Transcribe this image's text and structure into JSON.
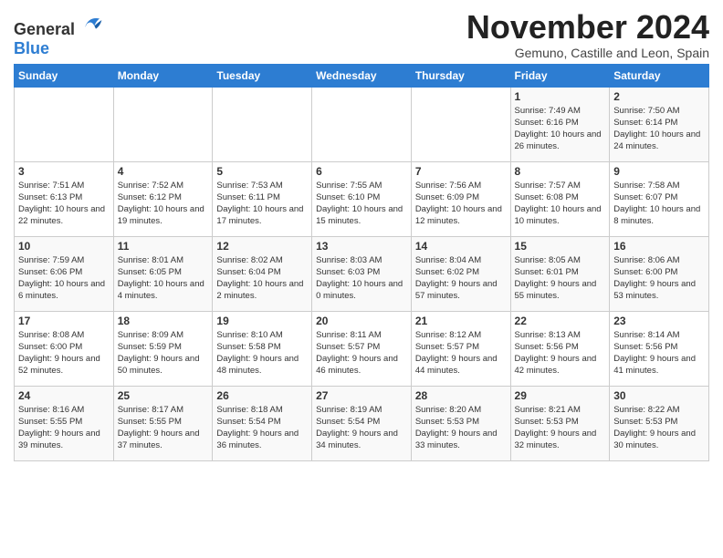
{
  "header": {
    "logo_general": "General",
    "logo_blue": "Blue",
    "month_title": "November 2024",
    "location": "Gemuno, Castille and Leon, Spain"
  },
  "weekdays": [
    "Sunday",
    "Monday",
    "Tuesday",
    "Wednesday",
    "Thursday",
    "Friday",
    "Saturday"
  ],
  "weeks": [
    [
      {
        "day": "",
        "info": ""
      },
      {
        "day": "",
        "info": ""
      },
      {
        "day": "",
        "info": ""
      },
      {
        "day": "",
        "info": ""
      },
      {
        "day": "",
        "info": ""
      },
      {
        "day": "1",
        "info": "Sunrise: 7:49 AM\nSunset: 6:16 PM\nDaylight: 10 hours and 26 minutes."
      },
      {
        "day": "2",
        "info": "Sunrise: 7:50 AM\nSunset: 6:14 PM\nDaylight: 10 hours and 24 minutes."
      }
    ],
    [
      {
        "day": "3",
        "info": "Sunrise: 7:51 AM\nSunset: 6:13 PM\nDaylight: 10 hours and 22 minutes."
      },
      {
        "day": "4",
        "info": "Sunrise: 7:52 AM\nSunset: 6:12 PM\nDaylight: 10 hours and 19 minutes."
      },
      {
        "day": "5",
        "info": "Sunrise: 7:53 AM\nSunset: 6:11 PM\nDaylight: 10 hours and 17 minutes."
      },
      {
        "day": "6",
        "info": "Sunrise: 7:55 AM\nSunset: 6:10 PM\nDaylight: 10 hours and 15 minutes."
      },
      {
        "day": "7",
        "info": "Sunrise: 7:56 AM\nSunset: 6:09 PM\nDaylight: 10 hours and 12 minutes."
      },
      {
        "day": "8",
        "info": "Sunrise: 7:57 AM\nSunset: 6:08 PM\nDaylight: 10 hours and 10 minutes."
      },
      {
        "day": "9",
        "info": "Sunrise: 7:58 AM\nSunset: 6:07 PM\nDaylight: 10 hours and 8 minutes."
      }
    ],
    [
      {
        "day": "10",
        "info": "Sunrise: 7:59 AM\nSunset: 6:06 PM\nDaylight: 10 hours and 6 minutes."
      },
      {
        "day": "11",
        "info": "Sunrise: 8:01 AM\nSunset: 6:05 PM\nDaylight: 10 hours and 4 minutes."
      },
      {
        "day": "12",
        "info": "Sunrise: 8:02 AM\nSunset: 6:04 PM\nDaylight: 10 hours and 2 minutes."
      },
      {
        "day": "13",
        "info": "Sunrise: 8:03 AM\nSunset: 6:03 PM\nDaylight: 10 hours and 0 minutes."
      },
      {
        "day": "14",
        "info": "Sunrise: 8:04 AM\nSunset: 6:02 PM\nDaylight: 9 hours and 57 minutes."
      },
      {
        "day": "15",
        "info": "Sunrise: 8:05 AM\nSunset: 6:01 PM\nDaylight: 9 hours and 55 minutes."
      },
      {
        "day": "16",
        "info": "Sunrise: 8:06 AM\nSunset: 6:00 PM\nDaylight: 9 hours and 53 minutes."
      }
    ],
    [
      {
        "day": "17",
        "info": "Sunrise: 8:08 AM\nSunset: 6:00 PM\nDaylight: 9 hours and 52 minutes."
      },
      {
        "day": "18",
        "info": "Sunrise: 8:09 AM\nSunset: 5:59 PM\nDaylight: 9 hours and 50 minutes."
      },
      {
        "day": "19",
        "info": "Sunrise: 8:10 AM\nSunset: 5:58 PM\nDaylight: 9 hours and 48 minutes."
      },
      {
        "day": "20",
        "info": "Sunrise: 8:11 AM\nSunset: 5:57 PM\nDaylight: 9 hours and 46 minutes."
      },
      {
        "day": "21",
        "info": "Sunrise: 8:12 AM\nSunset: 5:57 PM\nDaylight: 9 hours and 44 minutes."
      },
      {
        "day": "22",
        "info": "Sunrise: 8:13 AM\nSunset: 5:56 PM\nDaylight: 9 hours and 42 minutes."
      },
      {
        "day": "23",
        "info": "Sunrise: 8:14 AM\nSunset: 5:56 PM\nDaylight: 9 hours and 41 minutes."
      }
    ],
    [
      {
        "day": "24",
        "info": "Sunrise: 8:16 AM\nSunset: 5:55 PM\nDaylight: 9 hours and 39 minutes."
      },
      {
        "day": "25",
        "info": "Sunrise: 8:17 AM\nSunset: 5:55 PM\nDaylight: 9 hours and 37 minutes."
      },
      {
        "day": "26",
        "info": "Sunrise: 8:18 AM\nSunset: 5:54 PM\nDaylight: 9 hours and 36 minutes."
      },
      {
        "day": "27",
        "info": "Sunrise: 8:19 AM\nSunset: 5:54 PM\nDaylight: 9 hours and 34 minutes."
      },
      {
        "day": "28",
        "info": "Sunrise: 8:20 AM\nSunset: 5:53 PM\nDaylight: 9 hours and 33 minutes."
      },
      {
        "day": "29",
        "info": "Sunrise: 8:21 AM\nSunset: 5:53 PM\nDaylight: 9 hours and 32 minutes."
      },
      {
        "day": "30",
        "info": "Sunrise: 8:22 AM\nSunset: 5:53 PM\nDaylight: 9 hours and 30 minutes."
      }
    ]
  ]
}
